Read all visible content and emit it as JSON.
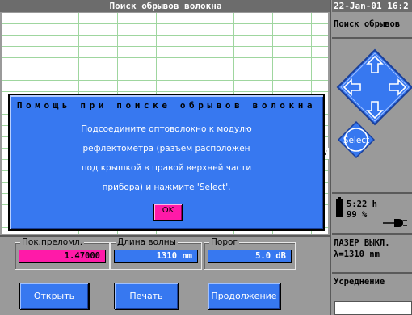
{
  "main": {
    "title": "Поиск обрывов волокна"
  },
  "sidebar": {
    "datetime": "22-Jan-01 16:2",
    "mode": "Поиск обрывов",
    "buttons": {
      "up": "up-arrow",
      "down": "down-arrow",
      "left": "left-arrow",
      "right": "right-arrow",
      "select": "Select"
    },
    "battery": {
      "time": "5:22 h",
      "percent": "99 %"
    },
    "laser": {
      "status": "ЛАЗЕР ВЫКЛ.",
      "wavelength": "λ=1310 nm"
    },
    "averaging_label": "Усреднение"
  },
  "params": {
    "index": {
      "label": "Пок.преломл.",
      "value": "1.47000"
    },
    "wavelength": {
      "label": "Длина волны",
      "value": "1310 nm"
    },
    "threshold": {
      "label": "Порог",
      "value": "5.0 dB"
    }
  },
  "buttons": {
    "open": "Открыть",
    "print": "Печать",
    "continue": "Продолжение"
  },
  "dialog": {
    "title": "Помощь при поиске обрывов волокна",
    "lines": [
      "Подсоедините оптоволокно к модулю",
      "рефлектометра (разъем расположен",
      "под крышкой в правой верхней части",
      "прибора) и нажмите 'Select'."
    ],
    "ok": "OK"
  },
  "grid_marker": "v",
  "colors": {
    "accent": "#3778f0",
    "highlight": "#ff1aa8",
    "grid": "#9fd69f"
  }
}
